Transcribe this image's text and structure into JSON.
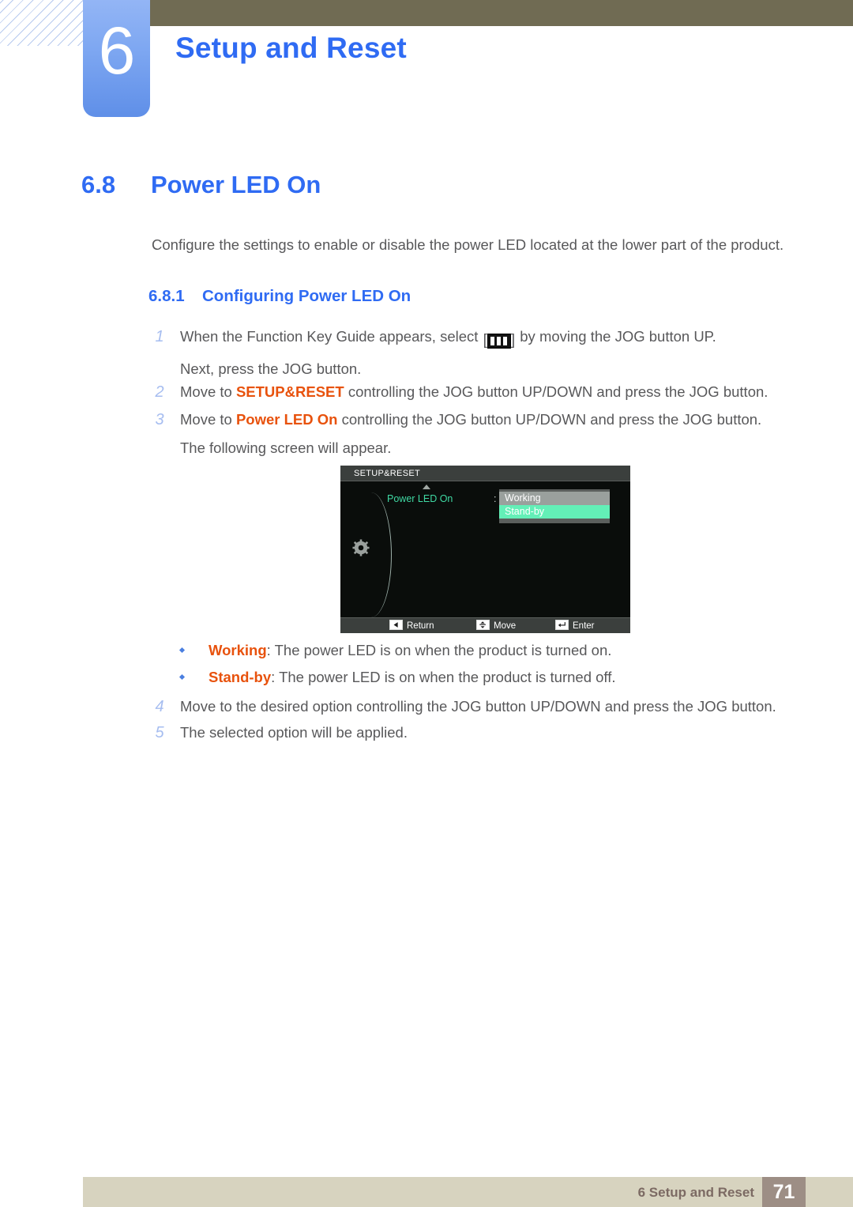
{
  "header": {
    "chapter_number": "6",
    "chapter_title": "Setup and Reset"
  },
  "section": {
    "number": "6.8",
    "title": "Power LED On",
    "intro": "Configure the settings to enable or disable the power LED located at the lower part of the product."
  },
  "subsection": {
    "number": "6.8.1",
    "title": "Configuring Power LED On"
  },
  "steps": [
    {
      "num": "1",
      "line1_before_icon": "When the Function Key Guide appears, select",
      "icon_open_bracket": "[",
      "icon_name": "function-key-guide-icon",
      "icon_close_bracket": "]",
      "line1_after_icon": "by moving the JOG button UP.",
      "line2": "Next, press the JOG button."
    },
    {
      "num": "2",
      "before": "Move to",
      "keyword": "SETUP&RESET",
      "after": "controlling the JOG button UP/DOWN and press the JOG button."
    },
    {
      "num": "3",
      "before": "Move to",
      "keyword": "Power LED On",
      "after": "controlling the JOG button UP/DOWN and press the JOG button.",
      "line2": "The following screen will appear."
    },
    {
      "num": "4",
      "text": "Move to the desired option controlling the JOG button UP/DOWN and press the JOG button."
    },
    {
      "num": "5",
      "text": "The selected option will be applied."
    }
  ],
  "osd": {
    "title": "SETUP&RESET",
    "item_label": "Power LED On",
    "colon": ":",
    "options": [
      {
        "label": "Working",
        "state": "normal"
      },
      {
        "label": "Stand-by",
        "state": "selected"
      }
    ],
    "gear_icon": "gear-icon",
    "up_arrow_icon": "chevron-up-icon",
    "footer_keys": [
      {
        "icon": "left-arrow-icon",
        "label": "Return"
      },
      {
        "icon": "up-down-arrow-icon",
        "label": "Move"
      },
      {
        "icon": "enter-arrow-icon",
        "label": "Enter"
      }
    ],
    "colors": {
      "background": "#0a0d0b",
      "bar": "#3b3f3d",
      "label_green": "#3fd9a3",
      "option_normal_bg": "#9aa09d",
      "option_selected_bg": "#63efb7"
    }
  },
  "bullets": [
    {
      "keyword": "Working",
      "text": ": The power LED is on when the product is turned on."
    },
    {
      "keyword": "Stand-by",
      "text": ": The power LED is on when the product is turned off."
    }
  ],
  "footer": {
    "label": "6 Setup and Reset",
    "page_number": "71"
  },
  "colors": {
    "accent_blue": "#2f6bf3",
    "keyword_orange": "#e8520d",
    "body_gray": "#58585a",
    "olive_bar": "#706b53",
    "footer_bar": "#d7d3bf",
    "footer_page_box": "#9d8e85"
  }
}
